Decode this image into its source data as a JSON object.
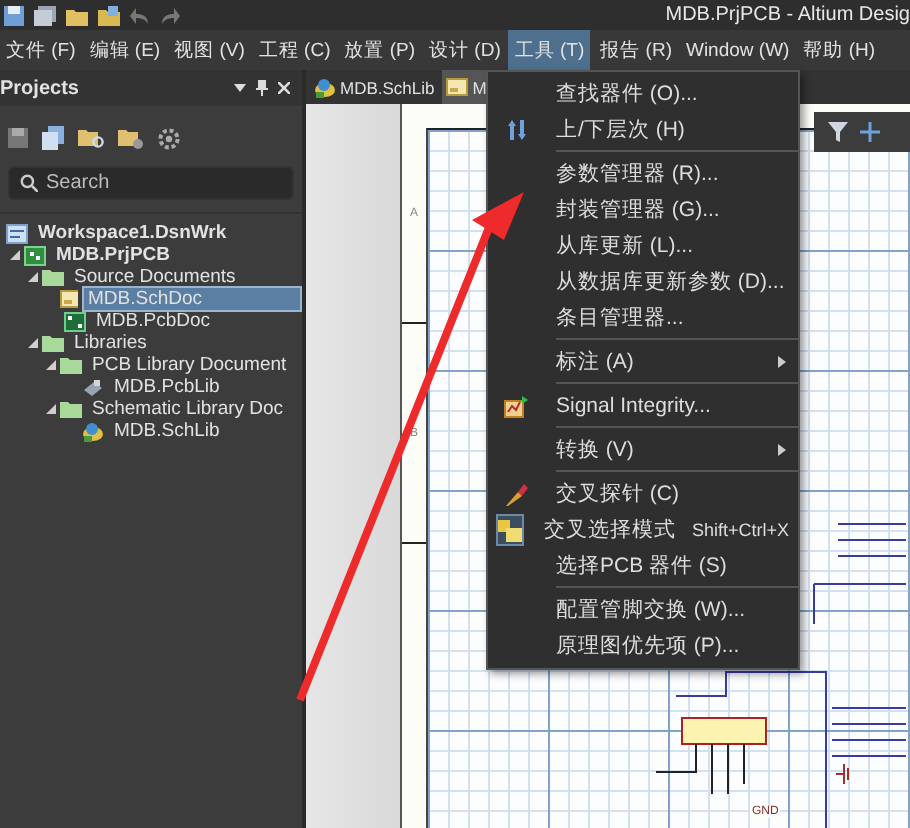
{
  "title_bar": {
    "title": "MDB.PrjPCB - Altium Desig"
  },
  "menu_bar": [
    {
      "label": "文件 (F)",
      "selected": false
    },
    {
      "label": "编辑 (E)",
      "selected": false
    },
    {
      "label": "视图 (V)",
      "selected": false
    },
    {
      "label": "工程 (C)",
      "selected": false
    },
    {
      "label": "放置 (P)",
      "selected": false
    },
    {
      "label": "设计 (D)",
      "selected": false
    },
    {
      "label": "工具 (T)",
      "selected": true
    },
    {
      "label": "报告 (R)",
      "selected": false
    },
    {
      "label": "Window (W)",
      "selected": false
    },
    {
      "label": "帮助 (H)",
      "selected": false
    }
  ],
  "projects_panel": {
    "title": "Projects",
    "search": {
      "placeholder": "Search"
    },
    "tree": [
      {
        "label": "Workspace1.DsnWrk",
        "kind": "workspace",
        "selected": false,
        "children": [
          {
            "label": "MDB.PrjPCB",
            "kind": "project",
            "expanded": true,
            "selected": false,
            "children": [
              {
                "label": "Source Documents",
                "kind": "folder",
                "expanded": true,
                "selected": false,
                "children": [
                  {
                    "label": "MDB.SchDoc",
                    "kind": "schdoc",
                    "selected": true
                  },
                  {
                    "label": "MDB.PcbDoc",
                    "kind": "pcbdoc",
                    "selected": false
                  }
                ]
              },
              {
                "label": "Libraries",
                "kind": "folder",
                "expanded": true,
                "selected": false,
                "children": [
                  {
                    "label": "PCB Library Document",
                    "kind": "folder",
                    "expanded": true,
                    "selected": false,
                    "children": [
                      {
                        "label": "MDB.PcbLib",
                        "kind": "pcblib",
                        "selected": false
                      }
                    ]
                  },
                  {
                    "label": "Schematic Library Doc",
                    "kind": "folder",
                    "expanded": true,
                    "selected": false,
                    "children": [
                      {
                        "label": "MDB.SchLib",
                        "kind": "schlib",
                        "selected": false
                      }
                    ]
                  }
                ]
              }
            ]
          }
        ]
      }
    ]
  },
  "document_tabs": [
    {
      "label": "MDB.SchLib",
      "kind": "schlib",
      "selected": false
    },
    {
      "label": "M",
      "kind": "schdoc",
      "selected": true
    }
  ],
  "sheet": {
    "zone_labels": [
      "A",
      "B"
    ],
    "net_label": "GND"
  },
  "tools_menu": [
    {
      "kind": "item",
      "label": "查找器件 (O)...",
      "checked": false
    },
    {
      "kind": "item",
      "label": "上/下层次 (H)",
      "checked": false
    },
    {
      "kind": "separator"
    },
    {
      "kind": "item",
      "label": "参数管理器 (R)...",
      "checked": false
    },
    {
      "kind": "item",
      "label": "封装管理器 (G)...",
      "checked": false
    },
    {
      "kind": "item",
      "label": "从库更新 (L)...",
      "checked": false
    },
    {
      "kind": "item",
      "label": "从数据库更新参数 (D)...",
      "checked": false
    },
    {
      "kind": "item",
      "label": "条目管理器...",
      "checked": false
    },
    {
      "kind": "separator"
    },
    {
      "kind": "submenu",
      "label": "标注 (A)",
      "checked": false
    },
    {
      "kind": "separator"
    },
    {
      "kind": "item",
      "label": "Signal Integrity...",
      "checked": false
    },
    {
      "kind": "separator"
    },
    {
      "kind": "submenu",
      "label": "转换 (V)",
      "checked": false
    },
    {
      "kind": "separator"
    },
    {
      "kind": "item",
      "label": "交叉探针 (C)",
      "checked": false
    },
    {
      "kind": "item",
      "label": "交叉选择模式",
      "shortcut": "Shift+Ctrl+X",
      "checked": true
    },
    {
      "kind": "item",
      "label": "选择PCB 器件 (S)",
      "checked": false
    },
    {
      "kind": "separator"
    },
    {
      "kind": "item",
      "label": "配置管脚交换 (W)...",
      "checked": false
    },
    {
      "kind": "item",
      "label": "原理图优先项 (P)...",
      "checked": false
    }
  ]
}
